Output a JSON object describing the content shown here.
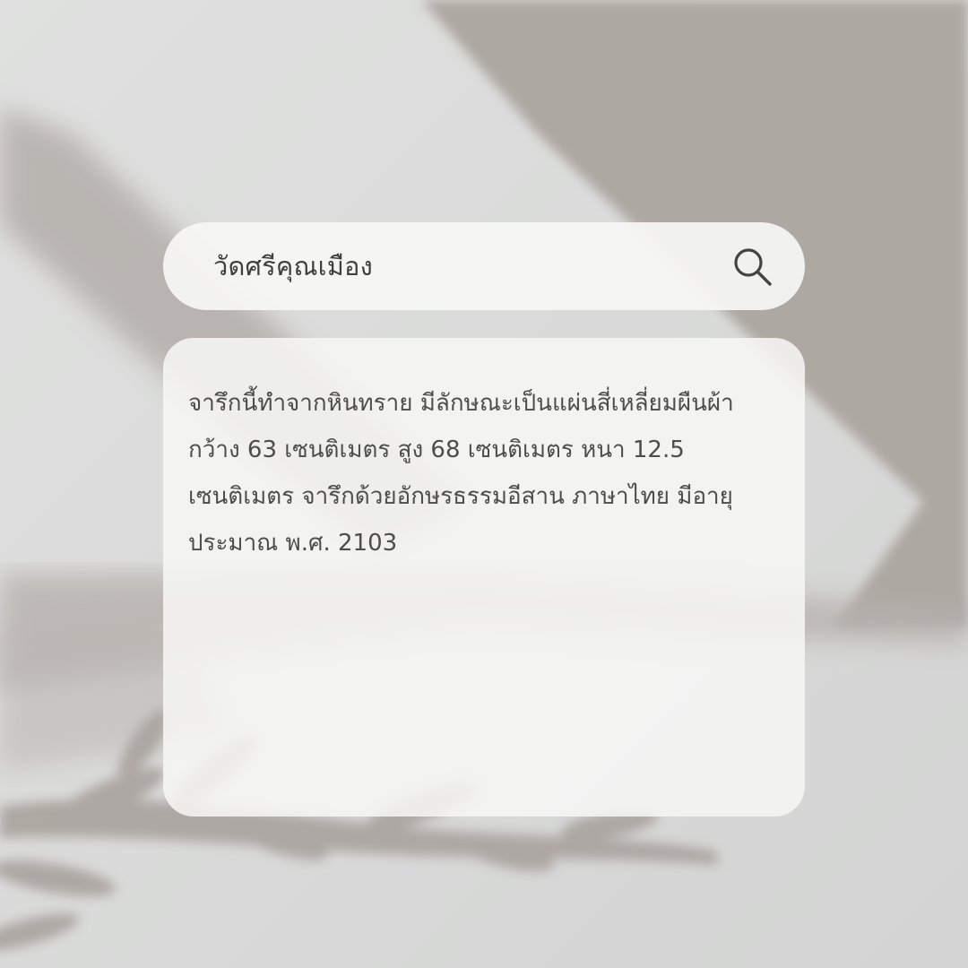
{
  "search": {
    "query": "วัดศรีคุณเมือง",
    "icon": "search-icon"
  },
  "result": {
    "text": "จารึกนี้ทำจากหินทราย มีลักษณะเป็นแผ่นสี่เหลี่ยมผืนผ้า กว้าง 63 เซนติเมตร สูง 68 เซนติเมตร หนา 12.5 เซนติเมตร จารึกด้วยอักษรธรรมอีสาน ภาษาไทย มีอายุประมาณ พ.ศ. 2103"
  },
  "colors": {
    "background": "#d7d8d7",
    "shadow": "#aea8a3",
    "panel": "#f6f6f5",
    "text": "#4d4d4d",
    "icon": "#444444"
  }
}
